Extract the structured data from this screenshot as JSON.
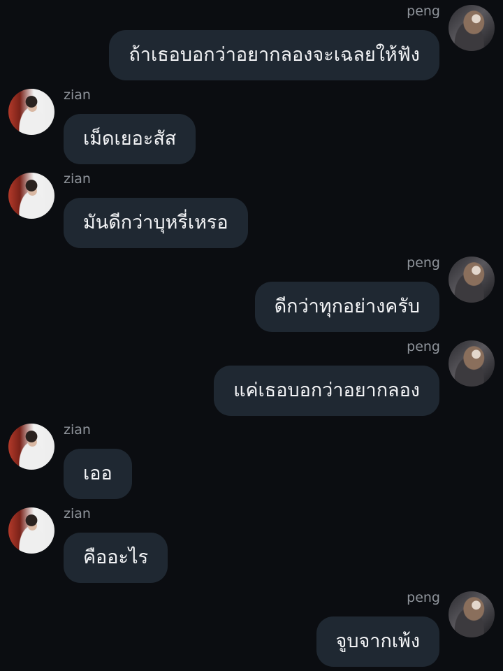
{
  "users": {
    "peng": {
      "name": "peng",
      "avatar_icon": "peng-avatar"
    },
    "zian": {
      "name": "zian",
      "avatar_icon": "zian-avatar"
    }
  },
  "colors": {
    "background": "#0b0d11",
    "bubble": "#1f2832",
    "message_text": "#f2f3f5",
    "sender_name": "#8f949b"
  },
  "messages": [
    {
      "sender": "peng",
      "text": "ถ้าเธอบอกว่าอยากลองจะเฉลยให้ฟัง"
    },
    {
      "sender": "zian",
      "text": "เม็ดเยอะสัส"
    },
    {
      "sender": "zian",
      "text": "มันดีกว่าบุหรี่เหรอ"
    },
    {
      "sender": "peng",
      "text": "ดีกว่าทุกอย่างครับ"
    },
    {
      "sender": "peng",
      "text": "แค่เธอบอกว่าอยากลอง"
    },
    {
      "sender": "zian",
      "text": "เออ"
    },
    {
      "sender": "zian",
      "text": "คืออะไร"
    },
    {
      "sender": "peng",
      "text": "จูบจากเพ้ง"
    }
  ]
}
